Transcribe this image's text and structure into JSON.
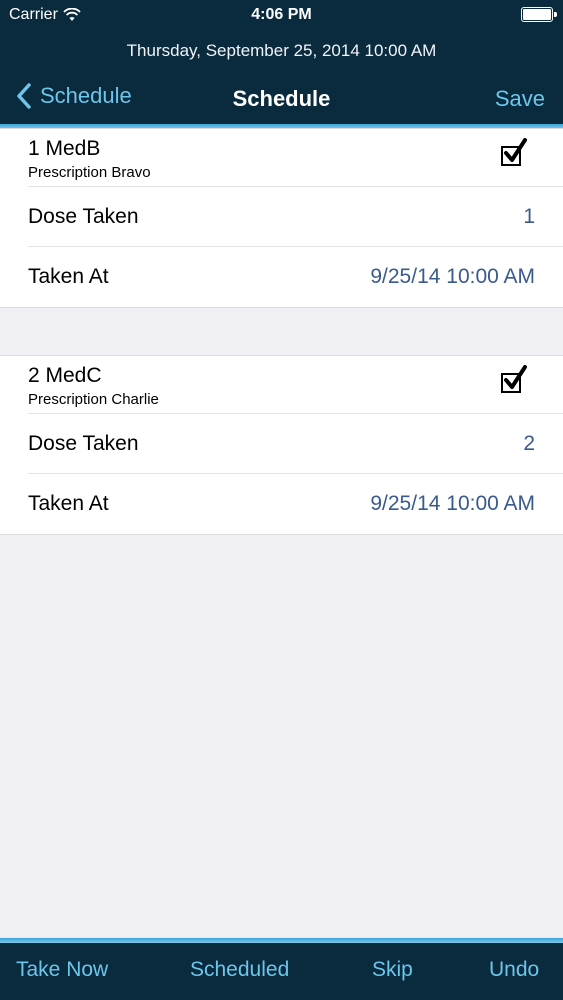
{
  "status_bar": {
    "carrier": "Carrier",
    "time": "4:06 PM"
  },
  "header": {
    "date_line": "Thursday, September 25, 2014 10:00 AM",
    "back_label": "Schedule",
    "title": "Schedule",
    "save_label": "Save"
  },
  "medications": [
    {
      "name": "1 MedB",
      "prescription": "Prescription Bravo",
      "checked": true,
      "dose_label": "Dose Taken",
      "dose_value": "1",
      "taken_label": "Taken At",
      "taken_value": "9/25/14 10:00 AM"
    },
    {
      "name": "2 MedC",
      "prescription": "Prescription Charlie",
      "checked": true,
      "dose_label": "Dose Taken",
      "dose_value": "2",
      "taken_label": "Taken At",
      "taken_value": "9/25/14 10:00 AM"
    }
  ],
  "tab_bar": {
    "take_now": "Take Now",
    "scheduled": "Scheduled",
    "skip": "Skip",
    "undo": "Undo"
  },
  "icons": {
    "wifi": "wifi-icon",
    "battery": "battery-icon",
    "back": "chevron-left-icon",
    "check": "checkmark-icon"
  },
  "colors": {
    "header_bg": "#0a2a3e",
    "accent": "#6ec5ea",
    "value_text": "#3a5a8c",
    "background": "#efeff4"
  }
}
